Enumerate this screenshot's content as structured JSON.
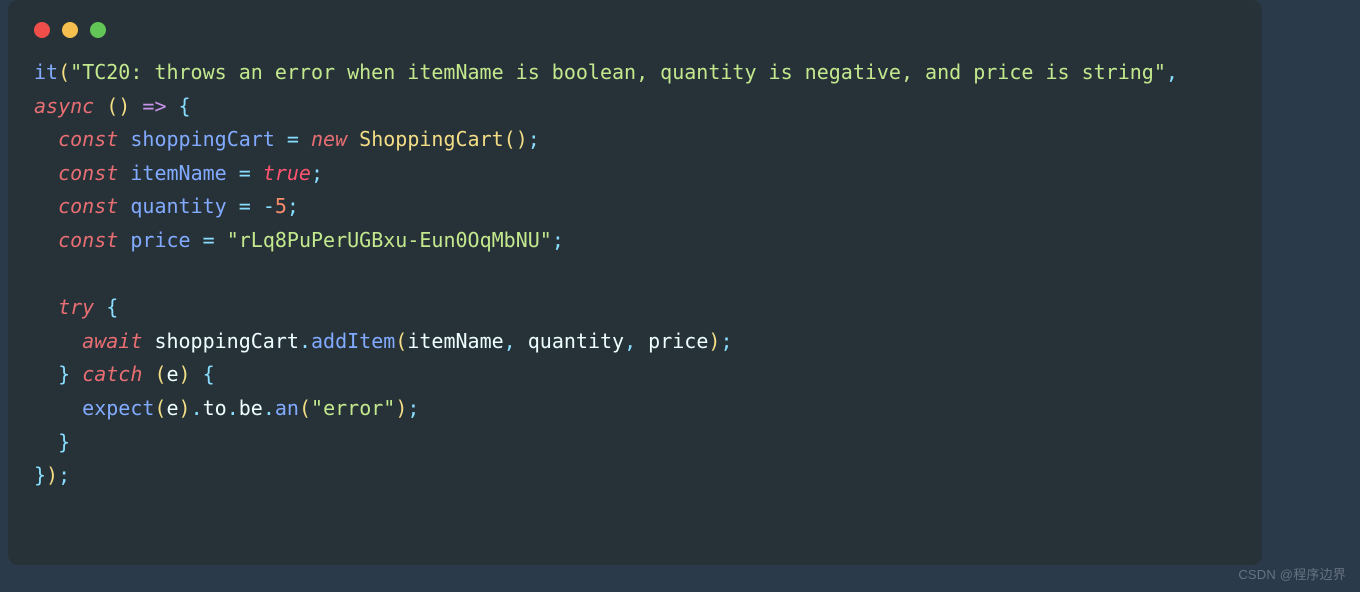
{
  "traffic_lights": {
    "red": "#ef4e4b",
    "yellow": "#f5bf4f",
    "green": "#62c656"
  },
  "code": {
    "t_it": "it",
    "t_lparen": "(",
    "t_str_open": "\"",
    "t_testname": "TC20: throws an error when itemName is boolean, quantity is negative, and price is string",
    "t_str_close": "\"",
    "t_comma_sp": ", ",
    "t_async": "async",
    "t_sp": " ",
    "t_empty_parens": "()",
    "t_arrow": " => ",
    "t_lbrace": "{",
    "t_indent2": "  ",
    "t_indent4": "    ",
    "t_const": "const",
    "t_shoppingCart": "shoppingCart",
    "t_eq": " = ",
    "t_new": "new",
    "t_ShoppingCart": "ShoppingCart",
    "t_call_parens": "()",
    "t_semi": ";",
    "t_itemName": "itemName",
    "t_true": "true",
    "t_quantity": "quantity",
    "t_neg5_minus": "-",
    "t_neg5_num": "5",
    "t_price": "price",
    "t_price_str": "rLq8PuPerUGBxu-Eun0OqMbNU",
    "t_try": "try",
    "t_await": "await",
    "t_dot": ".",
    "t_addItem": "addItem",
    "t_args_open": "(",
    "t_args_close": ")",
    "t_comma": ", ",
    "t_catch": "catch",
    "t_catch_open": " (",
    "t_e": "e",
    "t_catch_close": ") ",
    "t_expect": "expect",
    "t_to": "to",
    "t_be": "be",
    "t_an": "an",
    "t_error_str": "error",
    "t_rbrace": "}",
    "t_rparen": ")",
    "t_finalsemi": ";"
  },
  "watermark": "CSDN @程序边界"
}
